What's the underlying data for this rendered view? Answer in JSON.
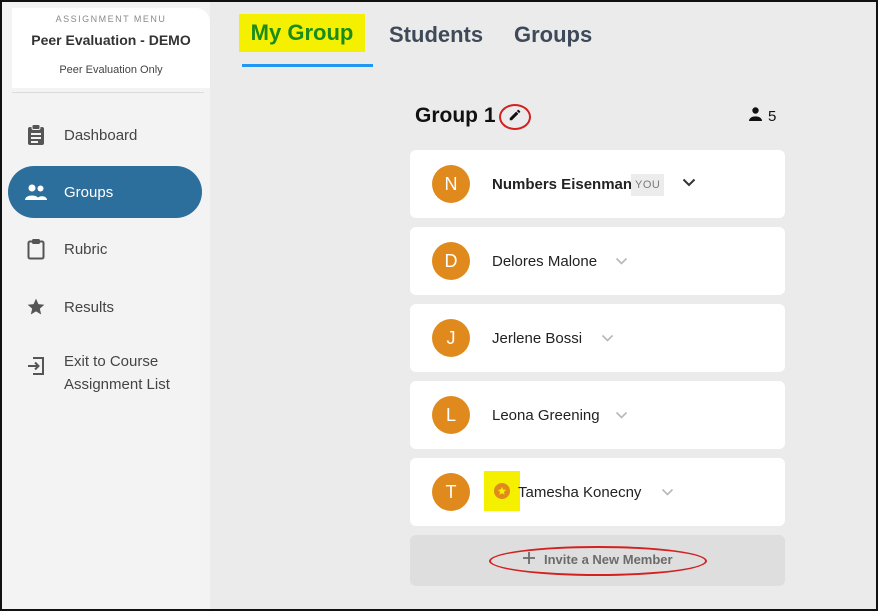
{
  "sidebar": {
    "menu_label": "ASSIGNMENT MENU",
    "title": "Peer Evaluation - DEMO",
    "subtitle": "Peer Evaluation Only",
    "items": [
      {
        "label": "Dashboard",
        "icon": "clipboard-list-icon"
      },
      {
        "label": "Groups",
        "icon": "people-icon",
        "active": true
      },
      {
        "label": "Rubric",
        "icon": "clipboard-icon"
      },
      {
        "label": "Results",
        "icon": "star-icon"
      },
      {
        "label": "Exit to Course Assignment List",
        "icon": "exit-icon"
      }
    ]
  },
  "tabs": [
    {
      "label": "My Group",
      "active": true
    },
    {
      "label": "Students"
    },
    {
      "label": "Groups"
    }
  ],
  "group": {
    "title": "Group 1",
    "member_count": "5"
  },
  "members": [
    {
      "initial": "N",
      "name": "Numbers Eisenman",
      "badge": "YOU"
    },
    {
      "initial": "D",
      "name": "Delores Malone"
    },
    {
      "initial": "J",
      "name": "Jerlene Bossi"
    },
    {
      "initial": "L",
      "name": "Leona Greening"
    },
    {
      "initial": "T",
      "name": "Tamesha Konecny",
      "leader_icon": "star-icon"
    }
  ],
  "invite": {
    "label": "Invite a New Member"
  },
  "colors": {
    "avatar": "#e08a1e",
    "nav_active": "#2d6f9c",
    "tab_underline": "#2196f3",
    "highlight": "#f5ef00",
    "annotation": "#d32020"
  }
}
